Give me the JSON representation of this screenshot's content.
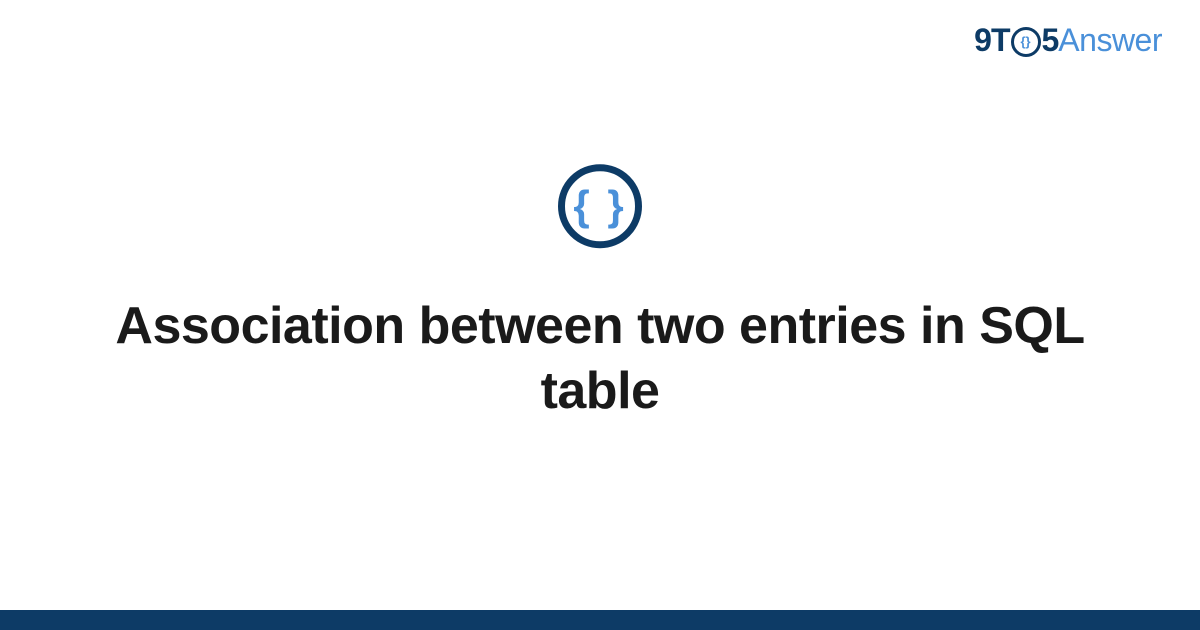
{
  "logo": {
    "part1": "9T",
    "braces_left": "{",
    "braces_right": "}",
    "part2": "5",
    "answer": "Answer"
  },
  "icon": {
    "braces": "{ }"
  },
  "title": "Association between two entries in SQL table",
  "colors": {
    "dark_blue": "#0d3b66",
    "light_blue": "#4a90d9"
  }
}
